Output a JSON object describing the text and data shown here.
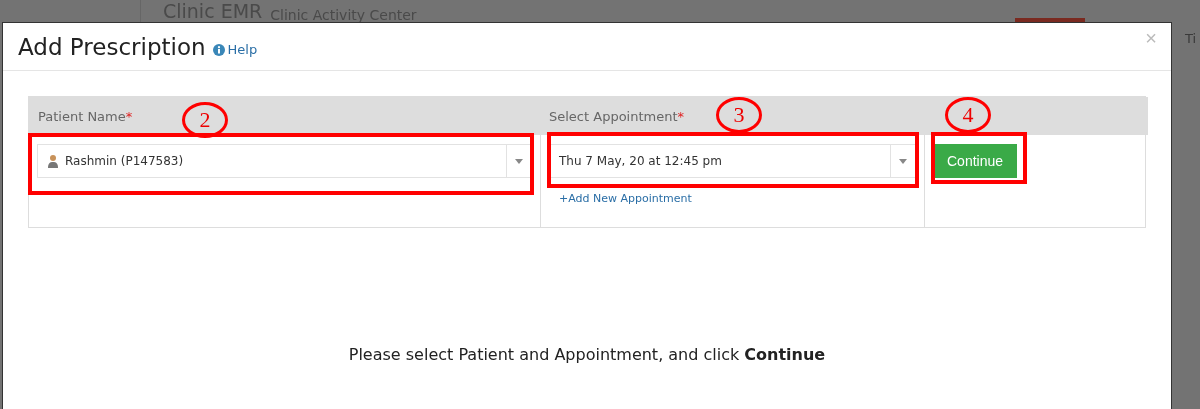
{
  "background_page": {
    "app_title": "Clinic EMR",
    "app_subtitle": "Clinic Activity Center",
    "nav_item": "Ti"
  },
  "modal": {
    "title": "Add Prescription",
    "help_link": "Help",
    "close": "×"
  },
  "form": {
    "columns": [
      {
        "label": "Patient Name",
        "required_mark": "*",
        "kind": "patient-select",
        "value": "Rashmin (P147583)",
        "annotation": "2"
      },
      {
        "label": "Select Appointment",
        "required_mark": "*",
        "kind": "appointment-select",
        "value": "Thu 7 May, 20 at 12:45 pm",
        "link": "+Add New Appointment",
        "annotation": "3"
      },
      {
        "kind": "button",
        "value": "Continue",
        "annotation": "4"
      }
    ]
  },
  "message": "Please select Patient and Appointment, and click **Continue**"
}
